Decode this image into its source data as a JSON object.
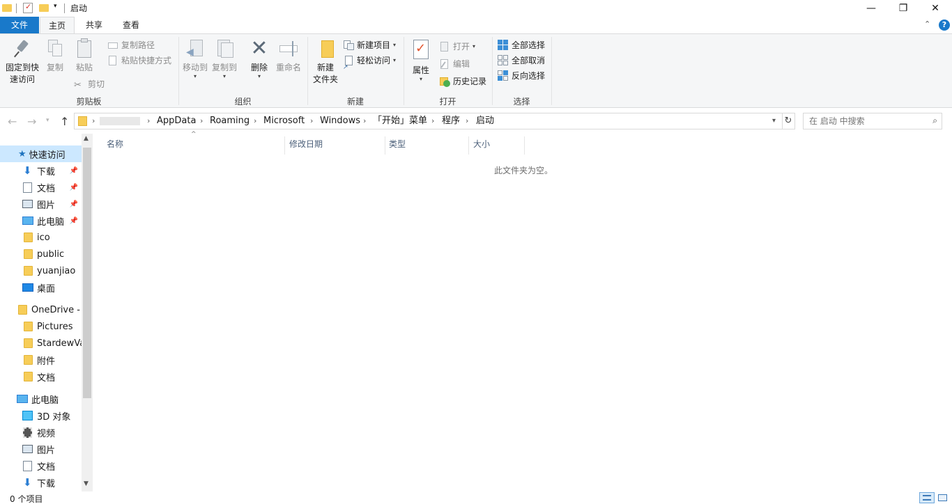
{
  "window": {
    "title": "启动",
    "controls": {
      "minimize": "—",
      "maximize": "❐",
      "close": "✕"
    }
  },
  "tabs": {
    "file": "文件",
    "home": "主页",
    "share": "共享",
    "view": "查看"
  },
  "ribbon": {
    "clipboard": {
      "pin_line1": "固定到快",
      "pin_line2": "速访问",
      "copy": "复制",
      "paste": "粘贴",
      "copy_path": "复制路径",
      "paste_shortcut": "粘贴快捷方式",
      "cut": "剪切",
      "group": "剪贴板"
    },
    "organize": {
      "move_to": "移动到",
      "copy_to": "复制到",
      "delete": "删除",
      "rename": "重命名",
      "group": "组织"
    },
    "new": {
      "new_folder_line1": "新建",
      "new_folder_line2": "文件夹",
      "new_item": "新建项目",
      "easy_access": "轻松访问",
      "group": "新建"
    },
    "open": {
      "properties": "属性",
      "open": "打开",
      "edit": "编辑",
      "history": "历史记录",
      "group": "打开"
    },
    "select": {
      "select_all": "全部选择",
      "select_none": "全部取消",
      "invert": "反向选择",
      "group": "选择"
    }
  },
  "address": {
    "crumbs": [
      "AppData",
      "Roaming",
      "Microsoft",
      "Windows",
      "「开始」菜单",
      "程序",
      "启动"
    ],
    "search_placeholder": "在 启动 中搜索"
  },
  "nav": {
    "quick_access": "快速访问",
    "items": [
      {
        "label": "下载",
        "icon": "download-icon",
        "pinned": true
      },
      {
        "label": "文档",
        "icon": "document-icon",
        "pinned": true
      },
      {
        "label": "图片",
        "icon": "pictures-icon",
        "pinned": true
      },
      {
        "label": "此电脑",
        "icon": "computer-icon",
        "pinned": true
      },
      {
        "label": "ico",
        "icon": "folder-icon",
        "pinned": false
      },
      {
        "label": "public",
        "icon": "folder-icon",
        "pinned": false
      },
      {
        "label": "yuanjiao",
        "icon": "folder-icon",
        "pinned": false
      },
      {
        "label": "桌面",
        "icon": "desktop-icon",
        "pinned": false
      }
    ],
    "onedrive": "OneDrive - P",
    "onedrive_items": [
      "Pictures",
      "StardewVa",
      "附件",
      "文档"
    ],
    "this_pc": "此电脑",
    "pc_items": [
      {
        "label": "3D 对象",
        "icon": "3d-objects-icon"
      },
      {
        "label": "视频",
        "icon": "video-icon"
      },
      {
        "label": "图片",
        "icon": "pictures-icon"
      },
      {
        "label": "文档",
        "icon": "document-icon"
      },
      {
        "label": "下载",
        "icon": "download-icon"
      }
    ]
  },
  "columns": {
    "name": "名称",
    "modified": "修改日期",
    "type": "类型",
    "size": "大小"
  },
  "content": {
    "empty_message": "此文件夹为空。"
  },
  "status": {
    "item_count": "0 个项目"
  }
}
